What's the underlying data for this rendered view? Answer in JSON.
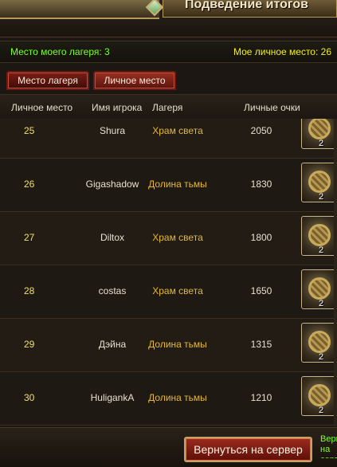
{
  "header": {
    "title": "Подведение итогов"
  },
  "status": {
    "camp_place": "Место моего лагеря: 3",
    "personal_place": "Мое личное место: 26"
  },
  "tabs": [
    {
      "label": "Место лагеря",
      "active": true
    },
    {
      "label": "Личное место",
      "active": false
    }
  ],
  "table": {
    "columns": [
      "Личное место",
      "Имя игрока",
      "Лагеря",
      "Личные очки"
    ],
    "rows": [
      {
        "rank": "25",
        "name": "Shura",
        "camp": "Храм света",
        "score": "2050",
        "reward_qty": "2"
      },
      {
        "rank": "26",
        "name": "Gigashadow",
        "camp": "Долина тьмы",
        "score": "1830",
        "reward_qty": "2"
      },
      {
        "rank": "27",
        "name": "Diltox",
        "camp": "Храм света",
        "score": "1800",
        "reward_qty": "2"
      },
      {
        "rank": "28",
        "name": "costas",
        "camp": "Храм света",
        "score": "1650",
        "reward_qty": "2"
      },
      {
        "rank": "29",
        "name": "Дэйна",
        "camp": "Долина тьмы",
        "score": "1315",
        "reward_qty": "2"
      },
      {
        "rank": "30",
        "name": "HuligankA",
        "camp": "Долина тьмы",
        "score": "1210",
        "reward_qty": "2"
      }
    ]
  },
  "footer": {
    "return_label": "Вернуться на сервер",
    "note": "Вернуться на сервер и получить награду"
  },
  "colors": {
    "accent_green": "#7cff2e",
    "accent_yellow": "#f0f020",
    "camp_gold": "#e6b830",
    "button_red": "#9a2a1e"
  },
  "icons": {
    "reward": "treasure-chest-icon",
    "ornament": "green-gem-icon"
  }
}
